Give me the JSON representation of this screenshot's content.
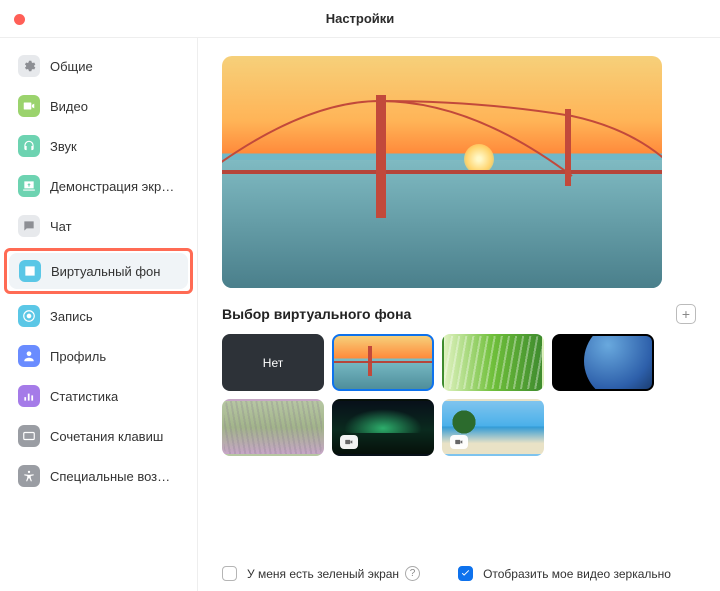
{
  "window": {
    "title": "Настройки"
  },
  "sidebar": {
    "items": [
      {
        "id": "general",
        "label": "Общие",
        "icon": "gear-icon",
        "color": "#e7e9ec",
        "fg": "#8d8f94"
      },
      {
        "id": "video",
        "label": "Видео",
        "icon": "video-icon",
        "color": "#9bd36d"
      },
      {
        "id": "audio",
        "label": "Звук",
        "icon": "headphones-icon",
        "color": "#6dd3b1"
      },
      {
        "id": "screenshare",
        "label": "Демонстрация экр…",
        "icon": "screen-share-icon",
        "color": "#6dd3b1"
      },
      {
        "id": "chat",
        "label": "Чат",
        "icon": "chat-icon",
        "color": "#e7e9ec",
        "fg": "#8d8f94"
      },
      {
        "id": "vbg",
        "label": "Виртуальный фон",
        "icon": "virtual-bg-icon",
        "color": "#5bc7e6",
        "selected": true,
        "highlighted": true
      },
      {
        "id": "recording",
        "label": "Запись",
        "icon": "record-icon",
        "color": "#5bc7e6"
      },
      {
        "id": "profile",
        "label": "Профиль",
        "icon": "profile-icon",
        "color": "#6a8cff"
      },
      {
        "id": "stats",
        "label": "Статистика",
        "icon": "stats-icon",
        "color": "#a57be8"
      },
      {
        "id": "shortcuts",
        "label": "Сочетания клавиш",
        "icon": "keyboard-icon",
        "color": "#9a9da3"
      },
      {
        "id": "a11y",
        "label": "Специальные возм…",
        "icon": "accessibility-icon",
        "color": "#9a9da3"
      }
    ]
  },
  "content": {
    "section_title": "Выбор виртуального фона",
    "add_label": "+",
    "thumbs": [
      {
        "id": "none",
        "label": "Нет",
        "kind": "none"
      },
      {
        "id": "bridge",
        "label": "",
        "kind": "bridge",
        "selected": true
      },
      {
        "id": "grass",
        "label": "",
        "kind": "grass"
      },
      {
        "id": "earth",
        "label": "",
        "kind": "earth"
      },
      {
        "id": "field",
        "label": "",
        "kind": "field"
      },
      {
        "id": "aurora",
        "label": "",
        "kind": "aurora",
        "video": true
      },
      {
        "id": "beach",
        "label": "",
        "kind": "beach",
        "video": true
      }
    ]
  },
  "footer": {
    "green_screen": {
      "label": "У меня есть зеленый экран",
      "checked": false
    },
    "mirror": {
      "label": "Отобразить мое видео зеркально",
      "checked": true
    }
  }
}
